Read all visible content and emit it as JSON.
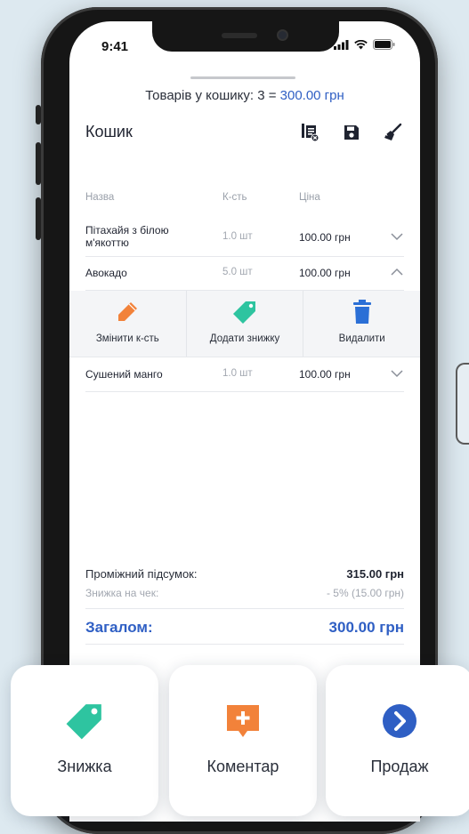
{
  "status": {
    "time": "9:41"
  },
  "cart_summary": {
    "prefix": "Товарів у кошику: 3 = ",
    "amount": "300.00 грн"
  },
  "cart": {
    "title": "Кошик"
  },
  "toolbar": {
    "icons": [
      "receipt-icon",
      "save-icon",
      "broom-icon"
    ]
  },
  "table": {
    "headers": {
      "name": "Назва",
      "qty": "К-сть",
      "price": "Ціна"
    },
    "rows": [
      {
        "name": "Пітахайя з білою м'якоттю",
        "qty": "1.0 шт",
        "price": "100.00 грн",
        "expanded": false
      },
      {
        "name": "Авокадо",
        "qty": "5.0 шт",
        "price": "100.00 грн",
        "expanded": true
      },
      {
        "name": "Сушений манго",
        "qty": "1.0 шт",
        "price": "100.00 грн",
        "expanded": false
      }
    ]
  },
  "row_actions": {
    "edit_qty": "Змінити к-сть",
    "add_discount": "Додати знижку",
    "delete": "Видалити"
  },
  "totals": {
    "subtotal_label": "Проміжний підсумок:",
    "subtotal_value": "315.00 грн",
    "discount_label": "Знижка на чек:",
    "discount_value": "- 5% (15.00 грн)",
    "total_label": "Загалом:",
    "total_value": "300.00 грн"
  },
  "bottom_cards": {
    "discount": "Знижка",
    "comment": "Коментар",
    "sale": "Продаж"
  },
  "colors": {
    "accent_blue": "#2f5fc4",
    "orange": "#f2823a",
    "teal": "#2ec4a0",
    "trash_blue": "#2b6fd6"
  }
}
